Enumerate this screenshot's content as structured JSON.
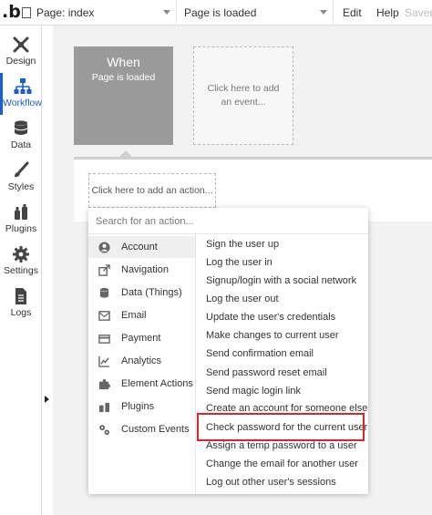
{
  "topbar": {
    "logo": ".b",
    "page_label": "Page: index",
    "event_label": "Page is loaded",
    "menu": {
      "edit": "Edit",
      "help": "Help",
      "saved": "Saved"
    }
  },
  "sidebar": {
    "items": [
      {
        "label": "Design",
        "icon": "design-icon"
      },
      {
        "label": "Workflow",
        "icon": "workflow-icon"
      },
      {
        "label": "Data",
        "icon": "database-icon"
      },
      {
        "label": "Styles",
        "icon": "brush-icon"
      },
      {
        "label": "Plugins",
        "icon": "plugins-icon"
      },
      {
        "label": "Settings",
        "icon": "gear-icon"
      },
      {
        "label": "Logs",
        "icon": "document-icon"
      }
    ],
    "active": "Workflow"
  },
  "canvas": {
    "when_title": "When",
    "when_event": "Page is loaded",
    "add_event": "Click here to add an event...",
    "add_action": "Click here to add an action..."
  },
  "dropdown": {
    "search_placeholder": "Search for an action...",
    "categories": [
      {
        "label": "Account",
        "icon": "account-icon"
      },
      {
        "label": "Navigation",
        "icon": "navigation-icon"
      },
      {
        "label": "Data (Things)",
        "icon": "database-icon"
      },
      {
        "label": "Email",
        "icon": "email-icon"
      },
      {
        "label": "Payment",
        "icon": "payment-icon"
      },
      {
        "label": "Analytics",
        "icon": "analytics-icon"
      },
      {
        "label": "Element Actions",
        "icon": "puzzle-icon"
      },
      {
        "label": "Plugins",
        "icon": "plugins-icon"
      },
      {
        "label": "Custom Events",
        "icon": "gears-icon"
      }
    ],
    "selected_category": "Account",
    "actions": [
      "Sign the user up",
      "Log the user in",
      "Signup/login with a social network",
      "Log the user out",
      "Update the user's credentials",
      "Make changes to current user",
      "Send confirmation email",
      "Send password reset email",
      "Send magic login link",
      "Create an account for someone else",
      "Check password for the current user",
      "Assign a temp password to a user",
      "Change the email for another user",
      "Log out other user's sessions"
    ],
    "highlighted_action": "Check password for the current user",
    "highlight_color": "#d8262b"
  },
  "colors": {
    "accent": "#1a5fd1",
    "when_card": "#9a9a9a",
    "canvas": "#f2f2f2"
  }
}
